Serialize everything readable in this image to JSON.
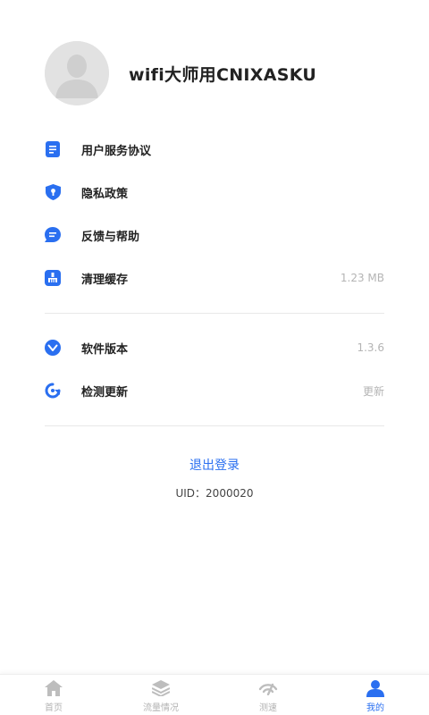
{
  "profile": {
    "username": "wifi大师用CNIXASKU"
  },
  "menu": {
    "agreement": "用户服务协议",
    "privacy": "隐私政策",
    "feedback": "反馈与帮助",
    "cache_label": "清理缓存",
    "cache_value": "1.23 MB",
    "version_label": "软件版本",
    "version_value": "1.3.6",
    "update_label": "检测更新",
    "update_value": "更新"
  },
  "logout": "退出登录",
  "uid": "UID：2000020",
  "tabbar": {
    "tabs": [
      {
        "label": "首页",
        "icon": "home-icon"
      },
      {
        "label": "流量情况",
        "icon": "layers-icon"
      },
      {
        "label": "测速",
        "icon": "speed-icon"
      },
      {
        "label": "我的",
        "icon": "user-icon"
      }
    ],
    "active_index": 3
  },
  "colors": {
    "accent": "#2a6ff0",
    "muted": "#b4b4b4"
  }
}
